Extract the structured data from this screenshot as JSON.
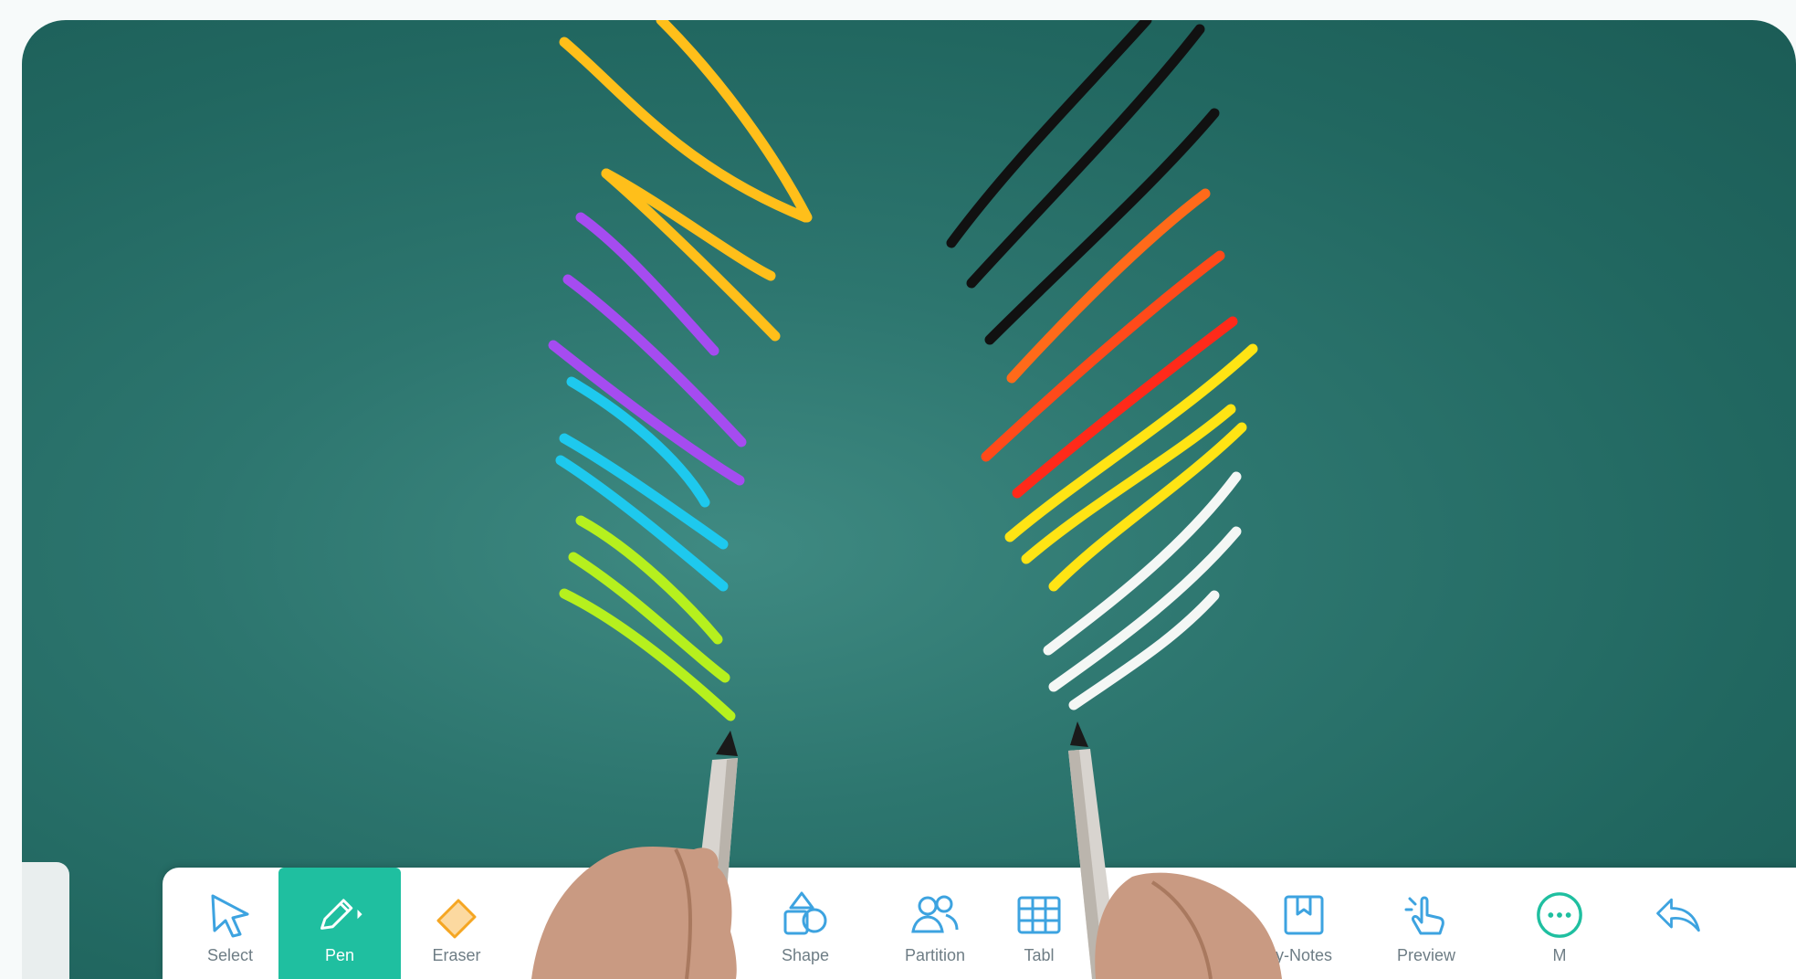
{
  "toolbar": {
    "tools": [
      {
        "label": "Select",
        "icon": "cursor-arrow-icon"
      },
      {
        "label": "Pen",
        "icon": "pen-icon",
        "active": true
      },
      {
        "label": "Eraser",
        "icon": "eraser-icon"
      },
      {
        "label": "Shape",
        "icon": "shape-icon"
      },
      {
        "label": "Partition",
        "icon": "partition-icon"
      },
      {
        "label": "Tabl",
        "icon": "table-icon"
      },
      {
        "label": "y-Notes",
        "icon": "notes-icon"
      },
      {
        "label": "Preview",
        "icon": "hand-pointer-icon"
      },
      {
        "label": "M",
        "icon": "more-icon"
      },
      {
        "label": "",
        "icon": "undo-icon"
      }
    ]
  },
  "colors": {
    "board": "#2a716b",
    "accent": "#1fbfa0",
    "icon": "#3da3e0",
    "stroke_left": [
      "#ffc21a",
      "#a54cf0",
      "#1ec9ee",
      "#b6f01e"
    ],
    "stroke_right": [
      "#111111",
      "#ff5a1a",
      "#ffe414",
      "#f4f7f5"
    ]
  }
}
